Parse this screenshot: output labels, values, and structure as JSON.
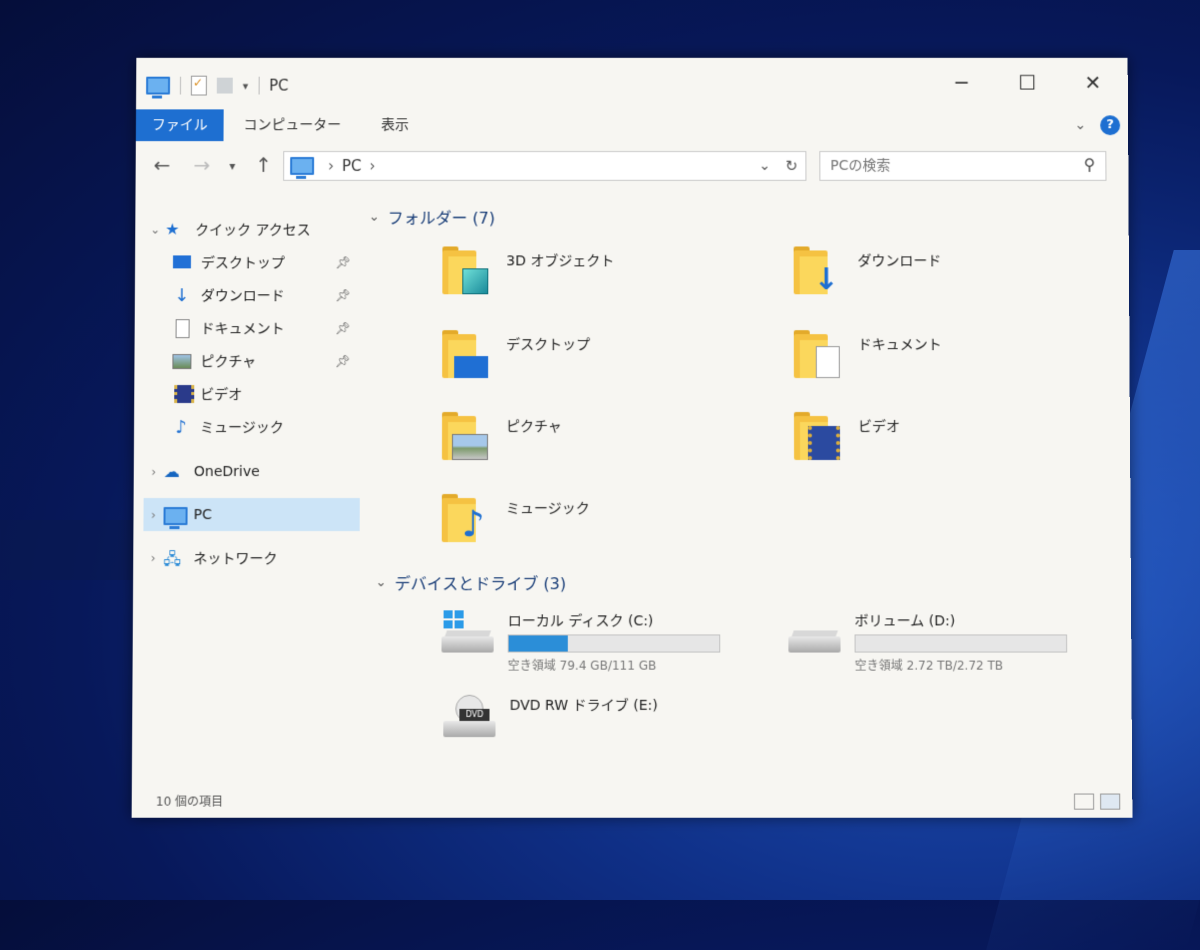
{
  "window": {
    "title": "PC",
    "controls": {
      "minimize": "─",
      "maximize": "☐",
      "close": "✕"
    }
  },
  "ribbon": {
    "tabs": [
      "ファイル",
      "コンピューター",
      "表示"
    ],
    "help": "?"
  },
  "address": {
    "path": [
      "PC"
    ],
    "search_placeholder": "PCの検索"
  },
  "sidebar": {
    "quick_access": "クイック アクセス",
    "quick_items": [
      {
        "label": "デスクトップ",
        "pinned": true
      },
      {
        "label": "ダウンロード",
        "pinned": true
      },
      {
        "label": "ドキュメント",
        "pinned": true
      },
      {
        "label": "ピクチャ",
        "pinned": true
      },
      {
        "label": "ビデオ",
        "pinned": false
      },
      {
        "label": "ミュージック",
        "pinned": false
      }
    ],
    "onedrive": "OneDrive",
    "pc": "PC",
    "network": "ネットワーク"
  },
  "content": {
    "folders_header": "フォルダー (7)",
    "folders": [
      {
        "label": "3D オブジェクト",
        "icon": "3d-objects-icon"
      },
      {
        "label": "ダウンロード",
        "icon": "download-icon"
      },
      {
        "label": "デスクトップ",
        "icon": "desktop-icon"
      },
      {
        "label": "ドキュメント",
        "icon": "document-icon"
      },
      {
        "label": "ピクチャ",
        "icon": "picture-icon"
      },
      {
        "label": "ビデオ",
        "icon": "video-icon"
      },
      {
        "label": "ミュージック",
        "icon": "music-icon"
      }
    ],
    "drives_header": "デバイスとドライブ (3)",
    "drives": [
      {
        "label": "ローカル ディスク (C:)",
        "free": "空き領域 79.4 GB/111 GB",
        "used_fraction": 0.28
      },
      {
        "label": "ボリューム (D:)",
        "free": "空き領域 2.72 TB/2.72 TB",
        "used_fraction": 0.0
      },
      {
        "label": "DVD RW ドライブ (E:)"
      }
    ]
  },
  "status": {
    "count": "10 個の項目"
  },
  "colors": {
    "accent": "#1e6fd1",
    "selection": "#cce4f7",
    "folder": "#f5c242"
  }
}
